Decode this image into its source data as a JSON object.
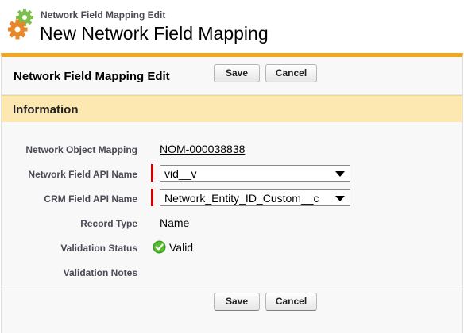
{
  "header": {
    "breadcrumb": "Network Field Mapping Edit",
    "title": "New Network Field Mapping"
  },
  "panel": {
    "title": "Network Field Mapping Edit",
    "save_label": "Save",
    "cancel_label": "Cancel"
  },
  "section": {
    "title": "Information"
  },
  "fields": {
    "network_object_mapping": {
      "label": "Network Object Mapping",
      "value": "NOM-000038838"
    },
    "network_field_api_name": {
      "label": "Network Field API Name",
      "value": "vid__v"
    },
    "crm_field_api_name": {
      "label": "CRM Field API Name",
      "value": "Network_Entity_ID_Custom__c"
    },
    "record_type": {
      "label": "Record Type",
      "value": "Name"
    },
    "validation_status": {
      "label": "Validation Status",
      "value": "Valid"
    },
    "validation_notes": {
      "label": "Validation Notes",
      "value": ""
    }
  },
  "colors": {
    "accent_orange": "#f3a51c",
    "section_header_bg": "#fde8b1",
    "required_red": "#cc0000",
    "valid_green": "#3a9e1e"
  },
  "icons": {
    "logo": "gears-icon",
    "valid": "check-circle-icon",
    "dropdown": "triangle-down-icon"
  }
}
